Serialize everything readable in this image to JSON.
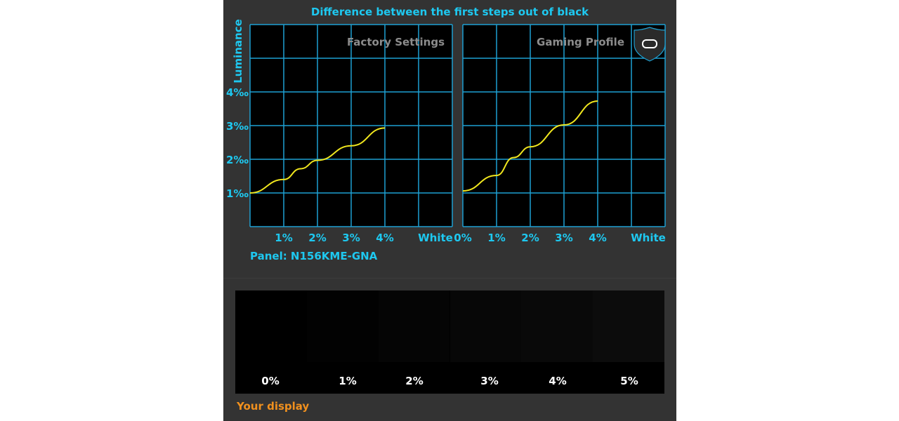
{
  "title": "Difference between the first steps out of black",
  "panel_label": "Panel: N156KME-GNA",
  "your_display_label": "Your display",
  "colors": {
    "grid": "#1ea0d2",
    "line": "#f0e61e",
    "text": "#1ec8f0",
    "inset_title": "#8c8c8c",
    "your_display": "#f0901e"
  },
  "chart_data": [
    {
      "type": "line",
      "title": "Factory Settings",
      "ylabel": "Luminance",
      "x_ticks": [
        "",
        "1%",
        "2%",
        "3%",
        "4%",
        "White"
      ],
      "y_ticks": [
        "1‰",
        "2‰",
        "3‰",
        "4‰"
      ],
      "y_tick_values": [
        1,
        2,
        3,
        4
      ],
      "ylim": [
        0,
        6
      ],
      "xlim": [
        0,
        6
      ],
      "grid": true,
      "series": [
        {
          "x": [
            0,
            1,
            1.5,
            2,
            3,
            4
          ],
          "y": [
            1.0,
            1.4,
            1.72,
            1.97,
            2.4,
            2.93
          ]
        }
      ]
    },
    {
      "type": "line",
      "title": "Gaming Profile",
      "icon": "gamepad-shield-icon",
      "x_ticks": [
        "0%",
        "1%",
        "2%",
        "3%",
        "4%",
        "White"
      ],
      "ylim": [
        0,
        6
      ],
      "xlim": [
        0,
        6
      ],
      "grid": true,
      "series": [
        {
          "x": [
            0,
            1,
            1.5,
            2,
            3,
            4
          ],
          "y": [
            1.06,
            1.52,
            2.05,
            2.37,
            3.02,
            3.73
          ]
        }
      ]
    }
  ],
  "patches": [
    {
      "label": "0%",
      "color": "#000000"
    },
    {
      "label": "1%",
      "color": "#020202"
    },
    {
      "label": "2%",
      "color": "#050505"
    },
    {
      "label": "3%",
      "color": "#070707"
    },
    {
      "label": "4%",
      "color": "#090909"
    },
    {
      "label": "5%",
      "color": "#0c0c0c"
    }
  ]
}
